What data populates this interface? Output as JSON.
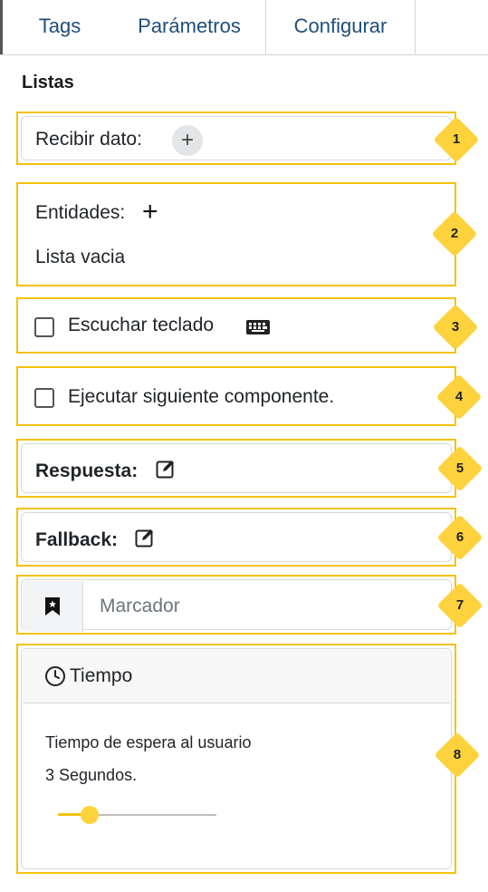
{
  "tabs": [
    {
      "label": "Tags"
    },
    {
      "label": "Parámetros"
    },
    {
      "label": "Configurar",
      "active": true
    }
  ],
  "section_title": "Listas",
  "receive": {
    "label": "Recibir dato:",
    "add_icon": "plus-icon"
  },
  "entities": {
    "label": "Entidades:",
    "empty_text": "Lista vacia",
    "add_icon": "plus-icon"
  },
  "listen_keyboard": {
    "label": "Escuchar teclado",
    "checked": false,
    "icon": "keyboard-icon"
  },
  "execute_next": {
    "label": "Ejecutar siguiente componente.",
    "checked": false
  },
  "response": {
    "label": "Respuesta:",
    "icon": "edit-icon"
  },
  "fallback": {
    "label": "Fallback:",
    "icon": "edit-icon"
  },
  "bookmark": {
    "placeholder": "Marcador",
    "value": "",
    "icon": "bookmark-icon"
  },
  "time": {
    "title": "Tiempo",
    "icon": "clock-icon",
    "description": "Tiempo de espera al usuario",
    "value_text": "3 Segundos.",
    "slider_fraction": 0.2
  },
  "badges": [
    "1",
    "2",
    "3",
    "4",
    "5",
    "6",
    "7",
    "8"
  ],
  "colors": {
    "highlight": "#f4c20d",
    "badge": "#fdd23c",
    "tab_text": "#1f4e79"
  }
}
